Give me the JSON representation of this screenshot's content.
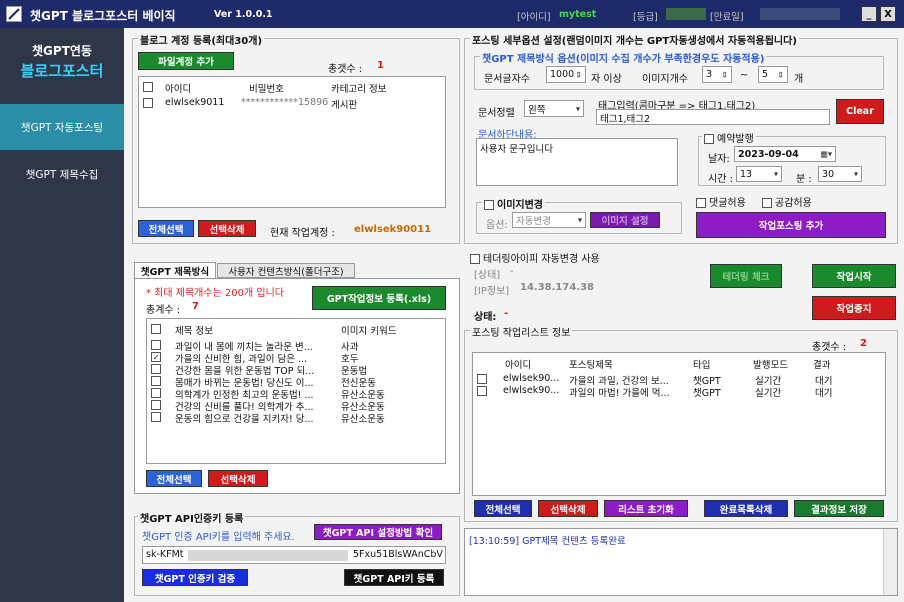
{
  "window": {
    "title": "챗GPT 블로그포스터 베이직",
    "version": "Ver 1.0.0.1",
    "id_label": "[아이디]",
    "id_value": "mytest",
    "grade_label": "[등급]",
    "expire_label": "[만료일]",
    "minimize": "_",
    "close": "X"
  },
  "sidebar": {
    "brand_line1": "챗GPT연동",
    "brand_line2": "블로그포스터",
    "items": [
      "챗GPT 자동포스팅",
      "챗GPT 제목수집"
    ]
  },
  "account": {
    "title": "블로그 계정 등록(최대30개)",
    "add_button": "파일계정 추가",
    "total_label": "총갯수 :",
    "total_value": "1",
    "headers": [
      "아이디",
      "비밀번호",
      "카테고리 정보"
    ],
    "rows": [
      {
        "id": "elwlsek9011",
        "pw": "************15896",
        "category": "게시판"
      }
    ],
    "select_all": "전체선택",
    "delete_selected": "선택삭제",
    "current_label": "현재 작업계정 :",
    "current_value": "elwlsek90011"
  },
  "titles": {
    "tab1": "챗GPT 제목방식",
    "tab2": "사용자 컨텐츠방식(폴더구조)",
    "note": "* 최대 제목개수는 200개 입니다",
    "register_button": "GPT작업정보 등록(.xls)",
    "total_label": "총계수 :",
    "total_value": "7",
    "headers": [
      "제목 정보",
      "이미지 키워드"
    ],
    "rows": [
      {
        "checked": false,
        "title": "과일이 내 몸에 끼치는 놀라운 변...",
        "keyword": "사과"
      },
      {
        "checked": true,
        "title": "가을의 신비한 힘, 과일이 담은 ...",
        "keyword": "호두"
      },
      {
        "checked": false,
        "title": "건강한 몸을 위한 운동법 TOP 되...",
        "keyword": "운동법"
      },
      {
        "checked": false,
        "title": "몸매가 바뀌는 운동법! 당신도 이...",
        "keyword": "전신운동"
      },
      {
        "checked": false,
        "title": "의학계가 인정한 최고의 운동법! ...",
        "keyword": "유산소운동"
      },
      {
        "checked": false,
        "title": "건강의 신비를 풀다! 의학계가 추...",
        "keyword": "유산소운동"
      },
      {
        "checked": false,
        "title": "운동의 힘으로 건강을 지키자! 당...",
        "keyword": "유산소운동"
      }
    ],
    "select_all": "전체선택",
    "delete_selected": "선택삭제"
  },
  "api": {
    "title": "챗GPT API인증키 등록",
    "hint": "챗GPT 인증 API키를 입력해 주세요.",
    "guide_button": "챗GPT API 설정방법 확인",
    "key_prefix": "sk-KFMt",
    "key_suffix": "5Fxu51BlsWAnCbV",
    "verify_button": "챗GPT 인증키 검증",
    "register_button": "챗GPT API키 등록"
  },
  "options": {
    "title": "포스팅 세부옵션 설정(랜덤이미지 개수는 GPT자동생성에서 자동적용됩니다)",
    "subtitle": "챗GPT 제목방식 옵션(이미지 수집 개수가 부족한경우도 자동적용)",
    "chars_label": "문서글자수",
    "chars_value": "1000",
    "chars_unit": "자 이상",
    "img_label": "이미지개수",
    "img_min": "3",
    "tilde": "~",
    "img_max": "5",
    "img_unit": "개",
    "align_label": "문서정렬",
    "align_value": "왼쪽",
    "tag_label": "태그입력(콤마구분 => 태그1,태그2)",
    "tag_value": "태그1,태그2",
    "clear_button": "Clear",
    "footer_label": "문서하단내용:",
    "footer_value": "사용자 문구입니다",
    "reserve_label": "예약발행",
    "date_label": "날자:",
    "date_value": "2023-09-04",
    "hour_label": "시간 :",
    "hour_value": "13",
    "min_label": "분 :",
    "min_value": "30",
    "img_change_label": "이미지변경",
    "img_option_label": "옵션:",
    "img_option_value": "자동변경",
    "img_setting_button": "이미지 설정",
    "comment_label": "댓글허용",
    "like_label": "공감허용",
    "add_job_button": "작업포스팅 추가"
  },
  "tethering": {
    "label": "테더링아이피 자동변경 사용",
    "status_label": "[상태]",
    "status_value": "-",
    "ip_label": "[IP정보]",
    "ip_value": "14.38.174.38",
    "check_button": "테더링 체크",
    "start_button": "작업시작",
    "stop_button": "작업중지"
  },
  "state": {
    "label": "상태:",
    "value": "-"
  },
  "jobs": {
    "title": "포스팅 작업리스트 정보",
    "total_label": "총갯수 :",
    "total_value": "2",
    "headers": [
      "아이디",
      "포스팅제목",
      "타입",
      "발행모드",
      "결과"
    ],
    "rows": [
      {
        "id": "elwlsek90...",
        "title": "가을의 과일, 건강의 보...",
        "type": "챗GPT",
        "mode": "실기간",
        "result": "대기"
      },
      {
        "id": "elwlsek90...",
        "title": "과일의 마법! 가을에 먹...",
        "type": "챗GPT",
        "mode": "실기간",
        "result": "대기"
      }
    ],
    "select_all": "전체선택",
    "delete_selected": "선택삭제",
    "reset_list": "리스트 초기화",
    "delete_done": "완료목록삭제",
    "save_result": "결과정보 저장"
  },
  "log": {
    "line": "[13:10:59] GPT제목 컨텐츠 등록완료"
  },
  "colors": {
    "titlebar": "#1f2a6b",
    "sidebar": "#2f3648",
    "accent_green": "#1b8a2c",
    "accent_red": "#cf1b1b",
    "accent_purple": "#8e1cc6"
  }
}
